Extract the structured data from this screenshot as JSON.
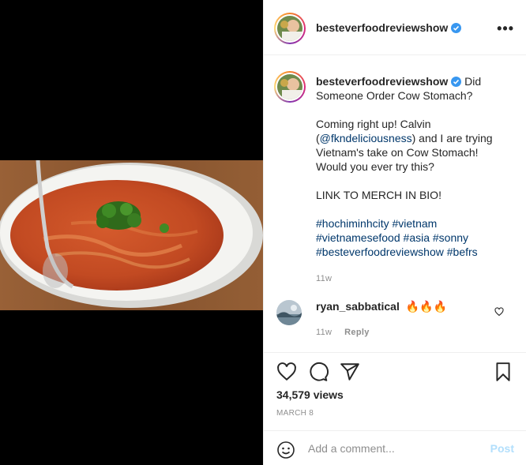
{
  "post": {
    "username": "besteverfoodreviewshow",
    "more_label": "•••",
    "caption": {
      "title_rest": "Did Someone Order Cow Stomach?",
      "line2_start": "Coming right up! Calvin (",
      "mention": "@fkndeliciousness",
      "line2_end": ") and I are trying Vietnam's take on Cow Stomach! Would you ever try this?",
      "merch": "LINK TO MERCH IN BIO!",
      "tags_line1": [
        "#hochiminhcity",
        "#vietnam"
      ],
      "tags_line2": [
        "#vietnamesefood",
        "#asia",
        "#sonny"
      ],
      "tags_line3": [
        "#besteverfoodreviewshow",
        "#befrs"
      ]
    },
    "caption_time": "11w"
  },
  "comment": {
    "username": "ryan_sabbatical",
    "text": "🔥🔥🔥",
    "time": "11w",
    "reply_label": "Reply"
  },
  "stats": {
    "views": "34,579 views",
    "date": "MARCH 8"
  },
  "add_comment": {
    "placeholder": "Add a comment...",
    "post_label": "Post"
  },
  "colors": {
    "verified": "#3897f0",
    "link": "#00376b",
    "muted": "#8e8e8e",
    "post_button_disabled": "#b2dffc"
  }
}
